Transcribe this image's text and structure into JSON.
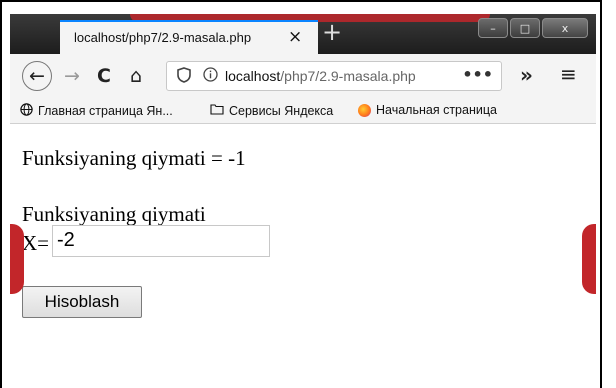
{
  "tab": {
    "title": "localhost/php7/2.9-masala.php",
    "close": "×",
    "new_tab": "+"
  },
  "window_controls": {
    "minimize": "–",
    "maximize": "□",
    "close": "x"
  },
  "toolbar": {
    "back": "←",
    "forward": "→",
    "reload": "C",
    "home": "⌂",
    "url_host": "localhost",
    "url_path": "/php7/2.9-masala.php",
    "page_actions": "•••",
    "overflow": "»",
    "menu": "≡"
  },
  "bookmarks": [
    {
      "label": "Главная страница Ян..."
    },
    {
      "label": "Сервисы Яндекса"
    },
    {
      "label": "Начальная страница"
    }
  ],
  "page": {
    "result_text": "Funksiyaning qiymati = -1",
    "form_label": "Funksiyaning qiymati",
    "x_label": "X=",
    "x_value": "-2",
    "submit_label": "Hisoblash"
  }
}
